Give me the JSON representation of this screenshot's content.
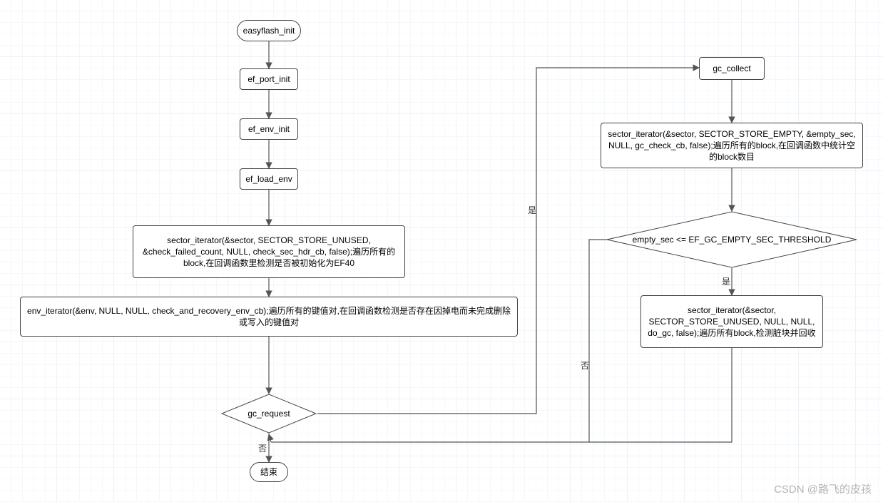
{
  "chart_data": {
    "type": "flowchart",
    "nodes": [
      {
        "id": "n1",
        "kind": "terminator",
        "label": "easyflash_init"
      },
      {
        "id": "n2",
        "kind": "process",
        "label": "ef_port_init"
      },
      {
        "id": "n3",
        "kind": "process",
        "label": "ef_env_init"
      },
      {
        "id": "n4",
        "kind": "process",
        "label": "ef_load_env"
      },
      {
        "id": "n5",
        "kind": "process",
        "label": "sector_iterator(&sector, SECTOR_STORE_UNUSED, &check_failed_count, NULL, check_sec_hdr_cb, false);遍历所有的block,在回调函数里检测是否被初始化为EF40"
      },
      {
        "id": "n6",
        "kind": "process",
        "label": "env_iterator(&env, NULL, NULL, check_and_recovery_env_cb);遍历所有的键值对,在回调函数检测是否存在因掉电而未完成删除或写入的键值对"
      },
      {
        "id": "n7",
        "kind": "decision",
        "label": "gc_request"
      },
      {
        "id": "n8",
        "kind": "terminator",
        "label": "结束"
      },
      {
        "id": "n9",
        "kind": "process",
        "label": "gc_collect"
      },
      {
        "id": "n10",
        "kind": "process",
        "label": "sector_iterator(&sector, SECTOR_STORE_EMPTY, &empty_sec, NULL, gc_check_cb, false);遍历所有的block,在回调函数中统计空的block数目"
      },
      {
        "id": "n11",
        "kind": "decision",
        "label": "empty_sec <= EF_GC_EMPTY_SEC_THRESHOLD"
      },
      {
        "id": "n12",
        "kind": "process",
        "label": "sector_iterator(&sector, SECTOR_STORE_UNUSED, NULL, NULL, do_gc, false);遍历所有block,检测脏块并回收"
      }
    ],
    "edges": [
      {
        "from": "n1",
        "to": "n2"
      },
      {
        "from": "n2",
        "to": "n3"
      },
      {
        "from": "n3",
        "to": "n4"
      },
      {
        "from": "n4",
        "to": "n5"
      },
      {
        "from": "n5",
        "to": "n6"
      },
      {
        "from": "n6",
        "to": "n7"
      },
      {
        "from": "n7",
        "to": "n8",
        "label": "否"
      },
      {
        "from": "n7",
        "to": "n9",
        "label": "是"
      },
      {
        "from": "n9",
        "to": "n10"
      },
      {
        "from": "n10",
        "to": "n11"
      },
      {
        "from": "n11",
        "to": "n12",
        "label": "是"
      },
      {
        "from": "n11",
        "to": "n7",
        "label": "否",
        "route": "back-down"
      },
      {
        "from": "n12",
        "to": "n7",
        "route": "back-down"
      }
    ],
    "edge_labels": {
      "yes": "是",
      "no": "否"
    }
  },
  "watermark": "CSDN @路飞的皮孩"
}
